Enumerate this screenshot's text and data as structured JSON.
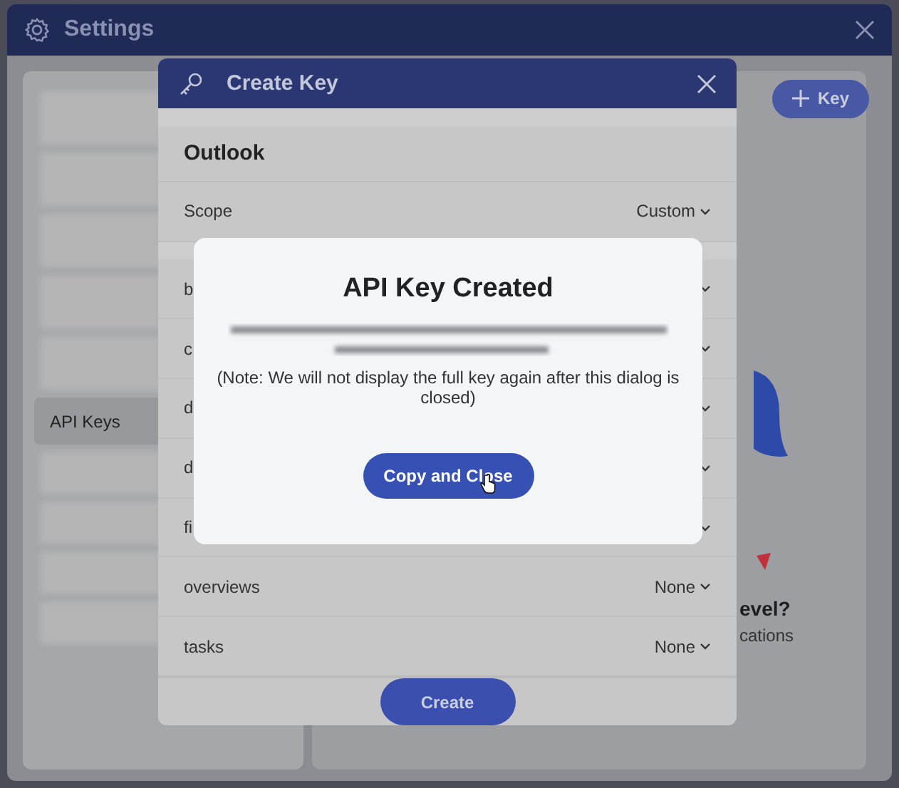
{
  "settings": {
    "title": "Settings",
    "add_key_button": "Key",
    "sidebar": {
      "items": [
        {
          "label": "API Keys",
          "selected": true
        }
      ]
    },
    "main": {
      "heading": "evel?",
      "subtext": "cations"
    }
  },
  "create_key": {
    "title": "Create Key",
    "app": "Outlook",
    "scope": {
      "label": "Scope",
      "value": "Custom"
    },
    "permissions": [
      {
        "label": "b"
      },
      {
        "label": "c"
      },
      {
        "label": "d"
      },
      {
        "label": "d"
      },
      {
        "label": "fi"
      },
      {
        "label": "overviews",
        "value": "None"
      },
      {
        "label": "tasks",
        "value": "None"
      }
    ],
    "submit": "Create"
  },
  "key_created": {
    "title": "API Key Created",
    "note": "(Note: We will not display the full key again after this dialog is closed)",
    "button": "Copy and Close"
  }
}
